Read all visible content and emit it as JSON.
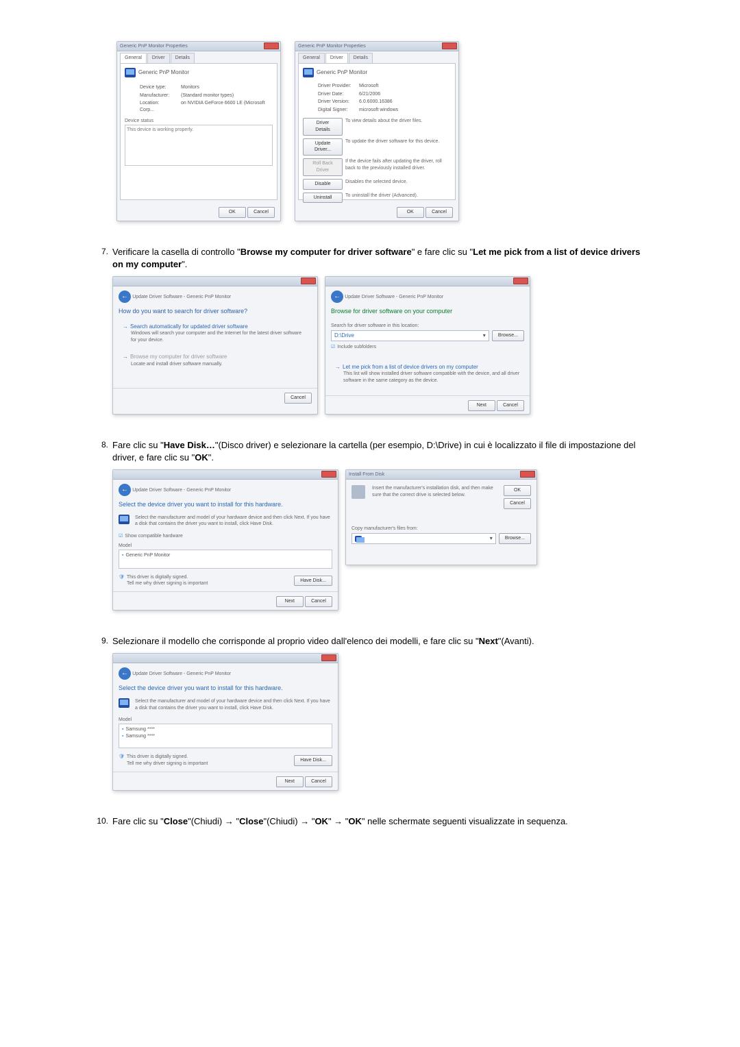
{
  "step7": {
    "num": "7.",
    "text_before": "Verificare la casella di controllo \"",
    "bold1": "Browse my computer for driver software",
    "text_mid": "\" e fare clic su \"",
    "bold2": "Let me pick from a list of device drivers on my computer",
    "text_after": "\"."
  },
  "step8": {
    "num": "8.",
    "text_before": "Fare clic su \"",
    "bold1": "Have Disk…",
    "text_mid1": "\"(Disco driver) e selezionare la cartella (per esempio, D:\\Drive) in cui è localizzato il file di impostazione del driver, e fare clic su \"",
    "bold2": "OK",
    "text_after": "\"."
  },
  "step9": {
    "num": "9.",
    "text_before": "Selezionare il modello che corrisponde al proprio video dall'elenco dei modelli, e fare clic su \"",
    "bold1": "Next",
    "text_after": "\"(Avanti)."
  },
  "step10": {
    "num": "10.",
    "text_before": "Fare clic su \"",
    "bold1": "Close",
    "text_mid1": "\"(Chiudi)  →  \"",
    "bold2": "Close",
    "text_mid2": "\"(Chiudi)  →  \"",
    "bold3": "OK",
    "text_mid3": "\"  →  \"",
    "bold4": "OK",
    "text_after": "\" nelle schermate seguenti visualizzate in sequenza."
  },
  "topwin1": {
    "title": "Generic PnP Monitor Properties",
    "tab1": "General",
    "tab2": "Driver",
    "tab3": "Details",
    "heading": "Generic PnP Monitor",
    "devtype_k": "Device type:",
    "devtype_v": "Monitors",
    "manuf_k": "Manufacturer:",
    "manuf_v": "(Standard monitor types)",
    "loc_k": "Location:",
    "loc_v": "on NVIDIA GeForce 6600 LE (Microsoft Corp...",
    "status_label": "Device status",
    "status_text": "This device is working properly.",
    "ok": "OK",
    "cancel": "Cancel"
  },
  "topwin2": {
    "title": "Generic PnP Monitor Properties",
    "tab1": "General",
    "tab2": "Driver",
    "tab3": "Details",
    "heading": "Generic PnP Monitor",
    "prov_k": "Driver Provider:",
    "prov_v": "Microsoft",
    "date_k": "Driver Date:",
    "date_v": "6/21/2006",
    "ver_k": "Driver Version:",
    "ver_v": "6.0.6000.16386",
    "sig_k": "Digital Signer:",
    "sig_v": "microsoft windows",
    "btn_details": "Driver Details",
    "txt_details": "To view details about the driver files.",
    "btn_update": "Update Driver...",
    "txt_update": "To update the driver software for this device.",
    "btn_rollback": "Roll Back Driver",
    "txt_rollback": "If the device fails after updating the driver, roll back to the previously installed driver.",
    "btn_disable": "Disable",
    "txt_disable": "Disables the selected device.",
    "btn_uninstall": "Uninstall",
    "txt_uninstall": "To uninstall the driver (Advanced).",
    "ok": "OK",
    "cancel": "Cancel"
  },
  "wiz1": {
    "crumb": "Update Driver Software - Generic PnP Monitor",
    "heading": "How do you want to search for driver software?",
    "opt1_title": "Search automatically for updated driver software",
    "opt1_desc": "Windows will search your computer and the Internet for the latest driver software for your device.",
    "opt2_title": "Browse my computer for driver software",
    "opt2_desc": "Locate and install driver software manually.",
    "cancel": "Cancel"
  },
  "wiz2": {
    "crumb": "Update Driver Software - Generic PnP Monitor",
    "heading": "Browse for driver software on your computer",
    "search_label": "Search for driver software in this location:",
    "path_hint": "D:\\Drive",
    "browse": "Browse...",
    "include": "Include subfolders",
    "pick_title": "Let me pick from a list of device drivers on my computer",
    "pick_desc": "This list will show installed driver software compatible with the device, and all driver software in the same category as the device.",
    "next": "Next",
    "cancel": "Cancel"
  },
  "wiz3": {
    "crumb": "Update Driver Software - Generic PnP Monitor",
    "heading": "Select the device driver you want to install for this hardware.",
    "instr": "Select the manufacturer and model of your hardware device and then click Next. If you have a disk that contains the driver you want to install, click Have Disk.",
    "show_compat": "Show compatible hardware",
    "model_label": "Model",
    "model1": "Generic PnP Monitor",
    "signed": "This driver is digitally signed.",
    "tellme": "Tell me why driver signing is important",
    "havedisk": "Have Disk...",
    "next": "Next",
    "cancel": "Cancel"
  },
  "install": {
    "title": "Install From Disk",
    "instr": "Insert the manufacturer's installation disk, and then make sure that the correct drive is selected below.",
    "ok": "OK",
    "cancel": "Cancel",
    "copy_label": "Copy manufacturer's files from:",
    "browse": "Browse..."
  },
  "wiz4": {
    "crumb": "Update Driver Software - Generic PnP Monitor",
    "heading": "Select the device driver you want to install for this hardware.",
    "instr": "Select the manufacturer and model of your hardware device and then click Next. If you have a disk that contains the driver you want to install, click Have Disk.",
    "model_label": "Model",
    "model1": "Samsung ****",
    "model2": "Samsung ****",
    "signed": "This driver is digitally signed.",
    "tellme": "Tell me why driver signing is important",
    "havedisk": "Have Disk...",
    "next": "Next",
    "cancel": "Cancel"
  }
}
